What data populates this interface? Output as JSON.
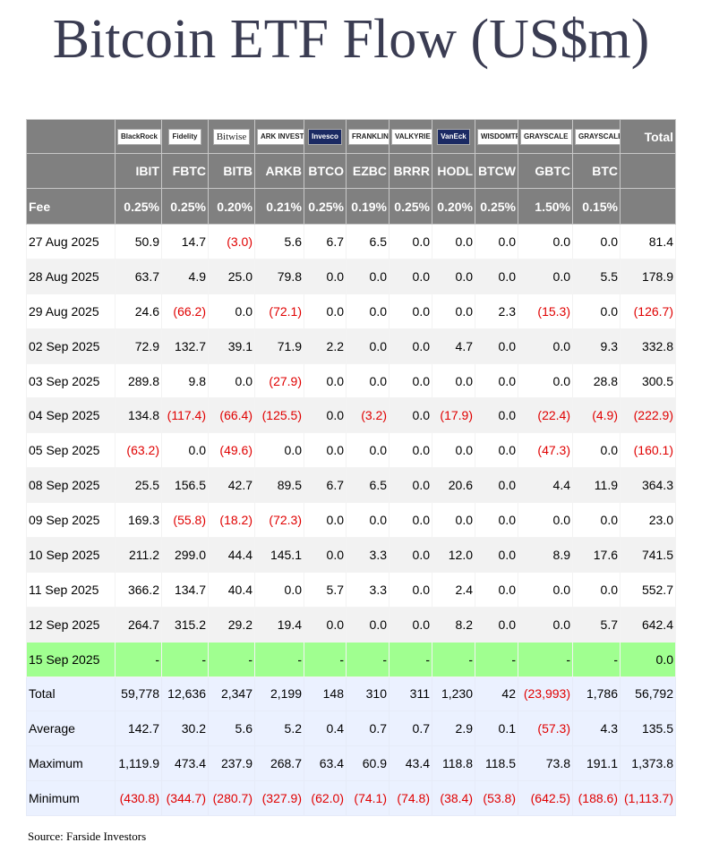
{
  "title": "Bitcoin ETF Flow (US$m)",
  "issuers": [
    {
      "logo": "BlackRock",
      "ticker": "IBIT",
      "fee": "0.25%"
    },
    {
      "logo": "Fidelity",
      "ticker": "FBTC",
      "fee": "0.25%"
    },
    {
      "logo": "Bitwise",
      "ticker": "BITB",
      "fee": "0.20%"
    },
    {
      "logo": "ARK INVEST",
      "ticker": "ARKB",
      "fee": "0.21%"
    },
    {
      "logo": "Invesco",
      "ticker": "BTCO",
      "fee": "0.25%"
    },
    {
      "logo": "FRANKLIN TEMPLETON",
      "ticker": "EZBC",
      "fee": "0.19%"
    },
    {
      "logo": "VALKYRIE",
      "ticker": "BRRR",
      "fee": "0.25%"
    },
    {
      "logo": "VanEck",
      "ticker": "HODL",
      "fee": "0.20%"
    },
    {
      "logo": "WISDOMTREE",
      "ticker": "BTCW",
      "fee": "0.25%"
    },
    {
      "logo": "GRAYSCALE",
      "ticker": "GBTC",
      "fee": "1.50%"
    },
    {
      "logo": "GRAYSCALE",
      "ticker": "BTC",
      "fee": "0.15%"
    }
  ],
  "header": {
    "total_label": "Total",
    "fee_label": "Fee"
  },
  "rows": [
    {
      "date": "27 Aug 2025",
      "values": [
        "50.9",
        "14.7",
        "(3.0)",
        "5.6",
        "6.7",
        "6.5",
        "0.0",
        "0.0",
        "0.0",
        "0.0",
        "0.0"
      ],
      "total": "81.4"
    },
    {
      "date": "28 Aug 2025",
      "values": [
        "63.7",
        "4.9",
        "25.0",
        "79.8",
        "0.0",
        "0.0",
        "0.0",
        "0.0",
        "0.0",
        "0.0",
        "5.5"
      ],
      "total": "178.9"
    },
    {
      "date": "29 Aug 2025",
      "values": [
        "24.6",
        "(66.2)",
        "0.0",
        "(72.1)",
        "0.0",
        "0.0",
        "0.0",
        "0.0",
        "2.3",
        "(15.3)",
        "0.0"
      ],
      "total": "(126.7)"
    },
    {
      "date": "02 Sep 2025",
      "values": [
        "72.9",
        "132.7",
        "39.1",
        "71.9",
        "2.2",
        "0.0",
        "0.0",
        "4.7",
        "0.0",
        "0.0",
        "9.3"
      ],
      "total": "332.8"
    },
    {
      "date": "03 Sep 2025",
      "values": [
        "289.8",
        "9.8",
        "0.0",
        "(27.9)",
        "0.0",
        "0.0",
        "0.0",
        "0.0",
        "0.0",
        "0.0",
        "28.8"
      ],
      "total": "300.5"
    },
    {
      "date": "04 Sep 2025",
      "values": [
        "134.8",
        "(117.4)",
        "(66.4)",
        "(125.5)",
        "0.0",
        "(3.2)",
        "0.0",
        "(17.9)",
        "0.0",
        "(22.4)",
        "(4.9)"
      ],
      "total": "(222.9)"
    },
    {
      "date": "05 Sep 2025",
      "values": [
        "(63.2)",
        "0.0",
        "(49.6)",
        "0.0",
        "0.0",
        "0.0",
        "0.0",
        "0.0",
        "0.0",
        "(47.3)",
        "0.0"
      ],
      "total": "(160.1)"
    },
    {
      "date": "08 Sep 2025",
      "values": [
        "25.5",
        "156.5",
        "42.7",
        "89.5",
        "6.7",
        "6.5",
        "0.0",
        "20.6",
        "0.0",
        "4.4",
        "11.9"
      ],
      "total": "364.3"
    },
    {
      "date": "09 Sep 2025",
      "values": [
        "169.3",
        "(55.8)",
        "(18.2)",
        "(72.3)",
        "0.0",
        "0.0",
        "0.0",
        "0.0",
        "0.0",
        "0.0",
        "0.0"
      ],
      "total": "23.0"
    },
    {
      "date": "10 Sep 2025",
      "values": [
        "211.2",
        "299.0",
        "44.4",
        "145.1",
        "0.0",
        "3.3",
        "0.0",
        "12.0",
        "0.0",
        "8.9",
        "17.6"
      ],
      "total": "741.5"
    },
    {
      "date": "11 Sep 2025",
      "values": [
        "366.2",
        "134.7",
        "40.4",
        "0.0",
        "5.7",
        "3.3",
        "0.0",
        "2.4",
        "0.0",
        "0.0",
        "0.0"
      ],
      "total": "552.7"
    },
    {
      "date": "12 Sep 2025",
      "values": [
        "264.7",
        "315.2",
        "29.2",
        "19.4",
        "0.0",
        "0.0",
        "0.0",
        "8.2",
        "0.0",
        "0.0",
        "5.7"
      ],
      "total": "642.4"
    },
    {
      "date": "15 Sep 2025",
      "values": [
        "-",
        "-",
        "-",
        "-",
        "-",
        "-",
        "-",
        "-",
        "-",
        "-",
        "-"
      ],
      "total": "0.0",
      "pending": true
    }
  ],
  "summary": [
    {
      "label": "Total",
      "values": [
        "59,778",
        "12,636",
        "2,347",
        "2,199",
        "148",
        "310",
        "311",
        "1,230",
        "42",
        "(23,993)",
        "1,786"
      ],
      "total": "56,792"
    },
    {
      "label": "Average",
      "values": [
        "142.7",
        "30.2",
        "5.6",
        "5.2",
        "0.4",
        "0.7",
        "0.7",
        "2.9",
        "0.1",
        "(57.3)",
        "4.3"
      ],
      "total": "135.5"
    },
    {
      "label": "Maximum",
      "values": [
        "1,119.9",
        "473.4",
        "237.9",
        "268.7",
        "63.4",
        "60.9",
        "43.4",
        "118.8",
        "118.5",
        "73.8",
        "191.1"
      ],
      "total": "1,373.8"
    },
    {
      "label": "Minimum",
      "values": [
        "(430.8)",
        "(344.7)",
        "(280.7)",
        "(327.9)",
        "(62.0)",
        "(74.1)",
        "(74.8)",
        "(38.4)",
        "(53.8)",
        "(642.5)",
        "(188.6)"
      ],
      "total": "(1,113.7)"
    }
  ],
  "source": "Source: Farside Investors",
  "colors": {
    "header_bg": "#808080",
    "negative": "#e00000",
    "pending_row": "#a0ff90",
    "summary_bg": "#ebf1ff",
    "title": "#3a3c52"
  }
}
